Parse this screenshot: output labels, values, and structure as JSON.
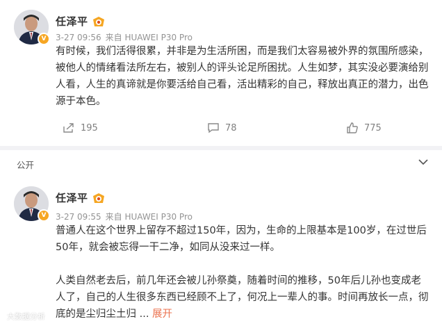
{
  "posts": [
    {
      "author": "任泽平",
      "time": "3-27 09:56",
      "source": "来自 HUAWEI P30 Pro",
      "content": [
        "有时候，我们活得很累，并非是为生活所困，而是我们太容易被外界的氛围所感染，被他人的情绪看法所左右，被别人的评头论足所困扰。人生如梦，其实没必要演给别人看，人生的真谛就是你要活给自己看，活出精彩的自己，释放出真正的潜力，出色源于本色。"
      ],
      "reposts": "195",
      "comments": "78",
      "likes": "775"
    },
    {
      "author": "任泽平",
      "time": "3-27 09:55",
      "source": "来自 HUAWEI P30 Pro",
      "content": [
        "普通人在这个世界上留存不超过150年，因为，生命的上限基本是100岁，在过世后50年，就会被忘得一干二净，如同从没来过一样。",
        "人类自然老去后，前几年还会被儿孙祭奠，随着时间的推移，50年后儿孙也变成老人了，自己的人生很多东西已经顾不上了，何况上一辈人的事。时间再放长一点，彻底的是尘归尘土归"
      ],
      "ellipsis": " ... ",
      "expand_label": "展开"
    }
  ],
  "section_label": "公开",
  "verified_badge": "V",
  "watermark": "大数据分析",
  "colors": {
    "accent": "#eb7350",
    "badge": "#f6a623",
    "meta": "#939393",
    "band": "#f2f2f5"
  },
  "icons": {
    "repost": "repost-icon",
    "comment": "comment-icon",
    "like": "like-icon",
    "chevron": "chevron-down-icon",
    "level": "level-badge-icon"
  }
}
